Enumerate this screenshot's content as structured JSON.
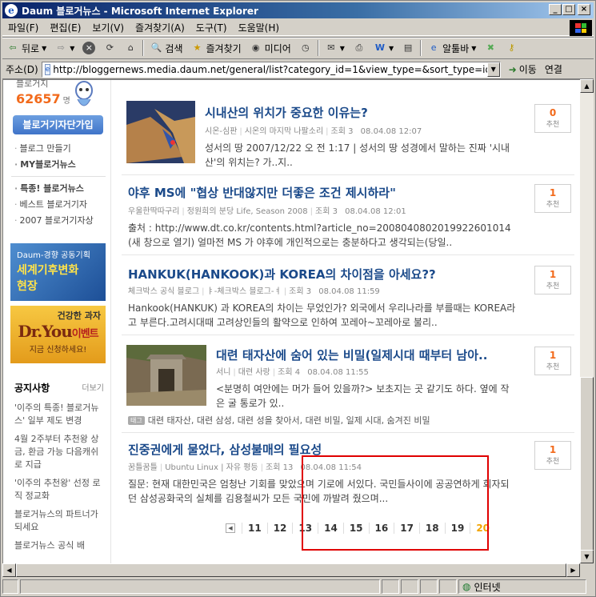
{
  "window": {
    "title": "Daum 블로거뉴스 - Microsoft Internet Explorer"
  },
  "menu": [
    "파일(F)",
    "편집(E)",
    "보기(V)",
    "즐겨찾기(A)",
    "도구(T)",
    "도움말(H)"
  ],
  "toolbar": {
    "back": "뒤로",
    "search": "검색",
    "favorites": "즐겨찾기",
    "media": "미디어",
    "alttoolbar": "알툴바"
  },
  "address": {
    "label": "주소(D)",
    "url": "http://bloggernews.media.daum.net/general/list?category_id=1&view_type=&sort_type=id&page",
    "go": "이동",
    "links": "연결"
  },
  "sidebar": {
    "top_label": "블로거지",
    "count": "62657",
    "count_unit": "명",
    "join_button": "블로거기자단가입",
    "links1": [
      "블로그 만들기",
      "MY블로거뉴스"
    ],
    "links2": [
      "특종! 블로거뉴스",
      "베스트 블로거기자",
      "2007 블로거기자상"
    ],
    "banner1": {
      "line1": "Daum-경향 공동기획",
      "line2": "세계기후변화",
      "line3": "현장"
    },
    "banner2": {
      "line1": "건강한 과자",
      "brand": "Dr.You",
      "brand_suffix": "이벤트",
      "line3": "지금 신청하세요!"
    },
    "notice_title": "공지사항",
    "notice_more": "더보기",
    "notices": [
      "'이주의 특종! 블로거뉴스' 일부 제도 변경",
      "4월 2주부터 추천왕 상금, 환금 가능 다음캐쉬로 지급",
      "'이주의 추천왕' 선정 로직 정교화",
      "블로거뉴스의 파트너가 되세요",
      "블로거뉴스 공식 배"
    ]
  },
  "posts": [
    {
      "title": "시내산의 위치가 중요한 이유는?",
      "author": "시온-심판",
      "blog": "시온의 마지막 나팔소리",
      "views": "조회 3",
      "date": "08.04.08 12:07",
      "body": "성서의 땅 2007/12/22 오 전 1:17 | 성서의 땅 성경에서 말하는 진짜 '시내산'의 위치는? 가..지..",
      "rec": "0",
      "rec_label": "추천"
    },
    {
      "title": "야후 MS에 \"협상 반대않지만 더좋은 조건 제시하라\"",
      "author": "우울한딱따구리",
      "blog": "정원희의 분당 Life, Season 2008",
      "views": "조회 3",
      "date": "08.04.08 12:01",
      "body": "출처 : http://www.dt.co.kr/contents.html?article_no=2008040802019922601014 (새 창으로 열기) 얼마전 MS 가 야후에 개인적으로는 충분하다고 생각되는(당일..",
      "rec": "1",
      "rec_label": "추천"
    },
    {
      "title": "HANKUK(HANKOOK)과 KOREA의 차이점을 아세요??",
      "author": "체크박스 공식 블로그",
      "blog": "ㅑ-체크박스 블로그-ㅕ",
      "views": "조회 3",
      "date": "08.04.08 11:59",
      "body": "Hankook(HANKUK) 과 KOREA의 차이는 무었인가? 외국에서 우리나라를 부를때는 KOREA라고 부른다.고려시대때 고려상인들의 활약으로 인하여 꼬레아~꼬레아로 불리..",
      "rec": "1",
      "rec_label": "추천"
    },
    {
      "title": "대련 태자산에 숨어 있는 비밀(일제시대 때부터 남아..",
      "author": "서니",
      "blog": "대련 사랑",
      "views": "조회 4",
      "date": "08.04.08 11:55",
      "body": "<분명히 여안에는 머가 들어 있을까?> 보초지는 곳 같기도 하다. 옆에 작은 굴 통로가 있..",
      "tag_icon": "태그",
      "tags": "대련 태자산, 대련 삼성, 대련 성을 찾아서, 대련 비밀, 일제 시대, 숨겨진 비밀",
      "rec": "1",
      "rec_label": "추천"
    },
    {
      "title": "진중권에게 물었다, 삼성불매의 필요성",
      "author": "꿈틀꿈틀",
      "blog": "Ubuntu Linux | 자유 평등",
      "views": "조회 13",
      "date": "08.04.08 11:54",
      "body": "질문: 현재 대한민국은 엄청난 기회를 맞았으며 기로에 서있다. 국민들사이에 공공연하게 회자되던 삼성공화국의 실체를 김용철씨가 모든 국민에 까발려 줬으며...",
      "rec": "1",
      "rec_label": "추천"
    }
  ],
  "pager": {
    "pages": [
      "11",
      "12",
      "13",
      "14",
      "15",
      "16",
      "17",
      "18",
      "19",
      "20"
    ],
    "current": "20"
  },
  "status": {
    "zone": "인터넷"
  }
}
